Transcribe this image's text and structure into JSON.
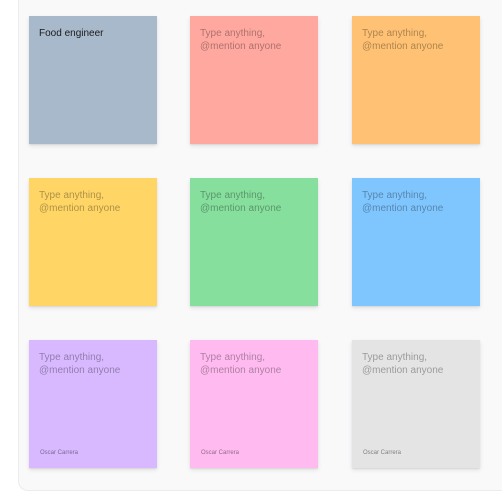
{
  "board": {
    "notes": [
      {
        "id": "note-1",
        "text": "Food engineer",
        "is_placeholder": false,
        "color": "#a9b9cc",
        "author": ""
      },
      {
        "id": "note-2",
        "text": "Type anything, @mention anyone",
        "is_placeholder": true,
        "color": "#ffa8a0",
        "author": ""
      },
      {
        "id": "note-3",
        "text": "Type anything, @mention anyone",
        "is_placeholder": true,
        "color": "#ffc274",
        "author": ""
      },
      {
        "id": "note-4",
        "text": "Type anything, @mention anyone",
        "is_placeholder": true,
        "color": "#ffd666",
        "author": ""
      },
      {
        "id": "note-5",
        "text": "Type anything, @mention anyone",
        "is_placeholder": true,
        "color": "#86df9d",
        "author": ""
      },
      {
        "id": "note-6",
        "text": "Type anything, @mention anyone",
        "is_placeholder": true,
        "color": "#7fc6ff",
        "author": ""
      },
      {
        "id": "note-7",
        "text": "Type anything, @mention anyone",
        "is_placeholder": true,
        "color": "#d8b9ff",
        "author": "Oscar Carrera"
      },
      {
        "id": "note-8",
        "text": "Type anything, @mention anyone",
        "is_placeholder": true,
        "color": "#ffbbf0",
        "author": "Oscar Carrera"
      },
      {
        "id": "note-9",
        "text": "Type anything, @mention anyone",
        "is_placeholder": true,
        "color": "#e4e4e4",
        "author": "Oscar Carrera"
      }
    ]
  }
}
